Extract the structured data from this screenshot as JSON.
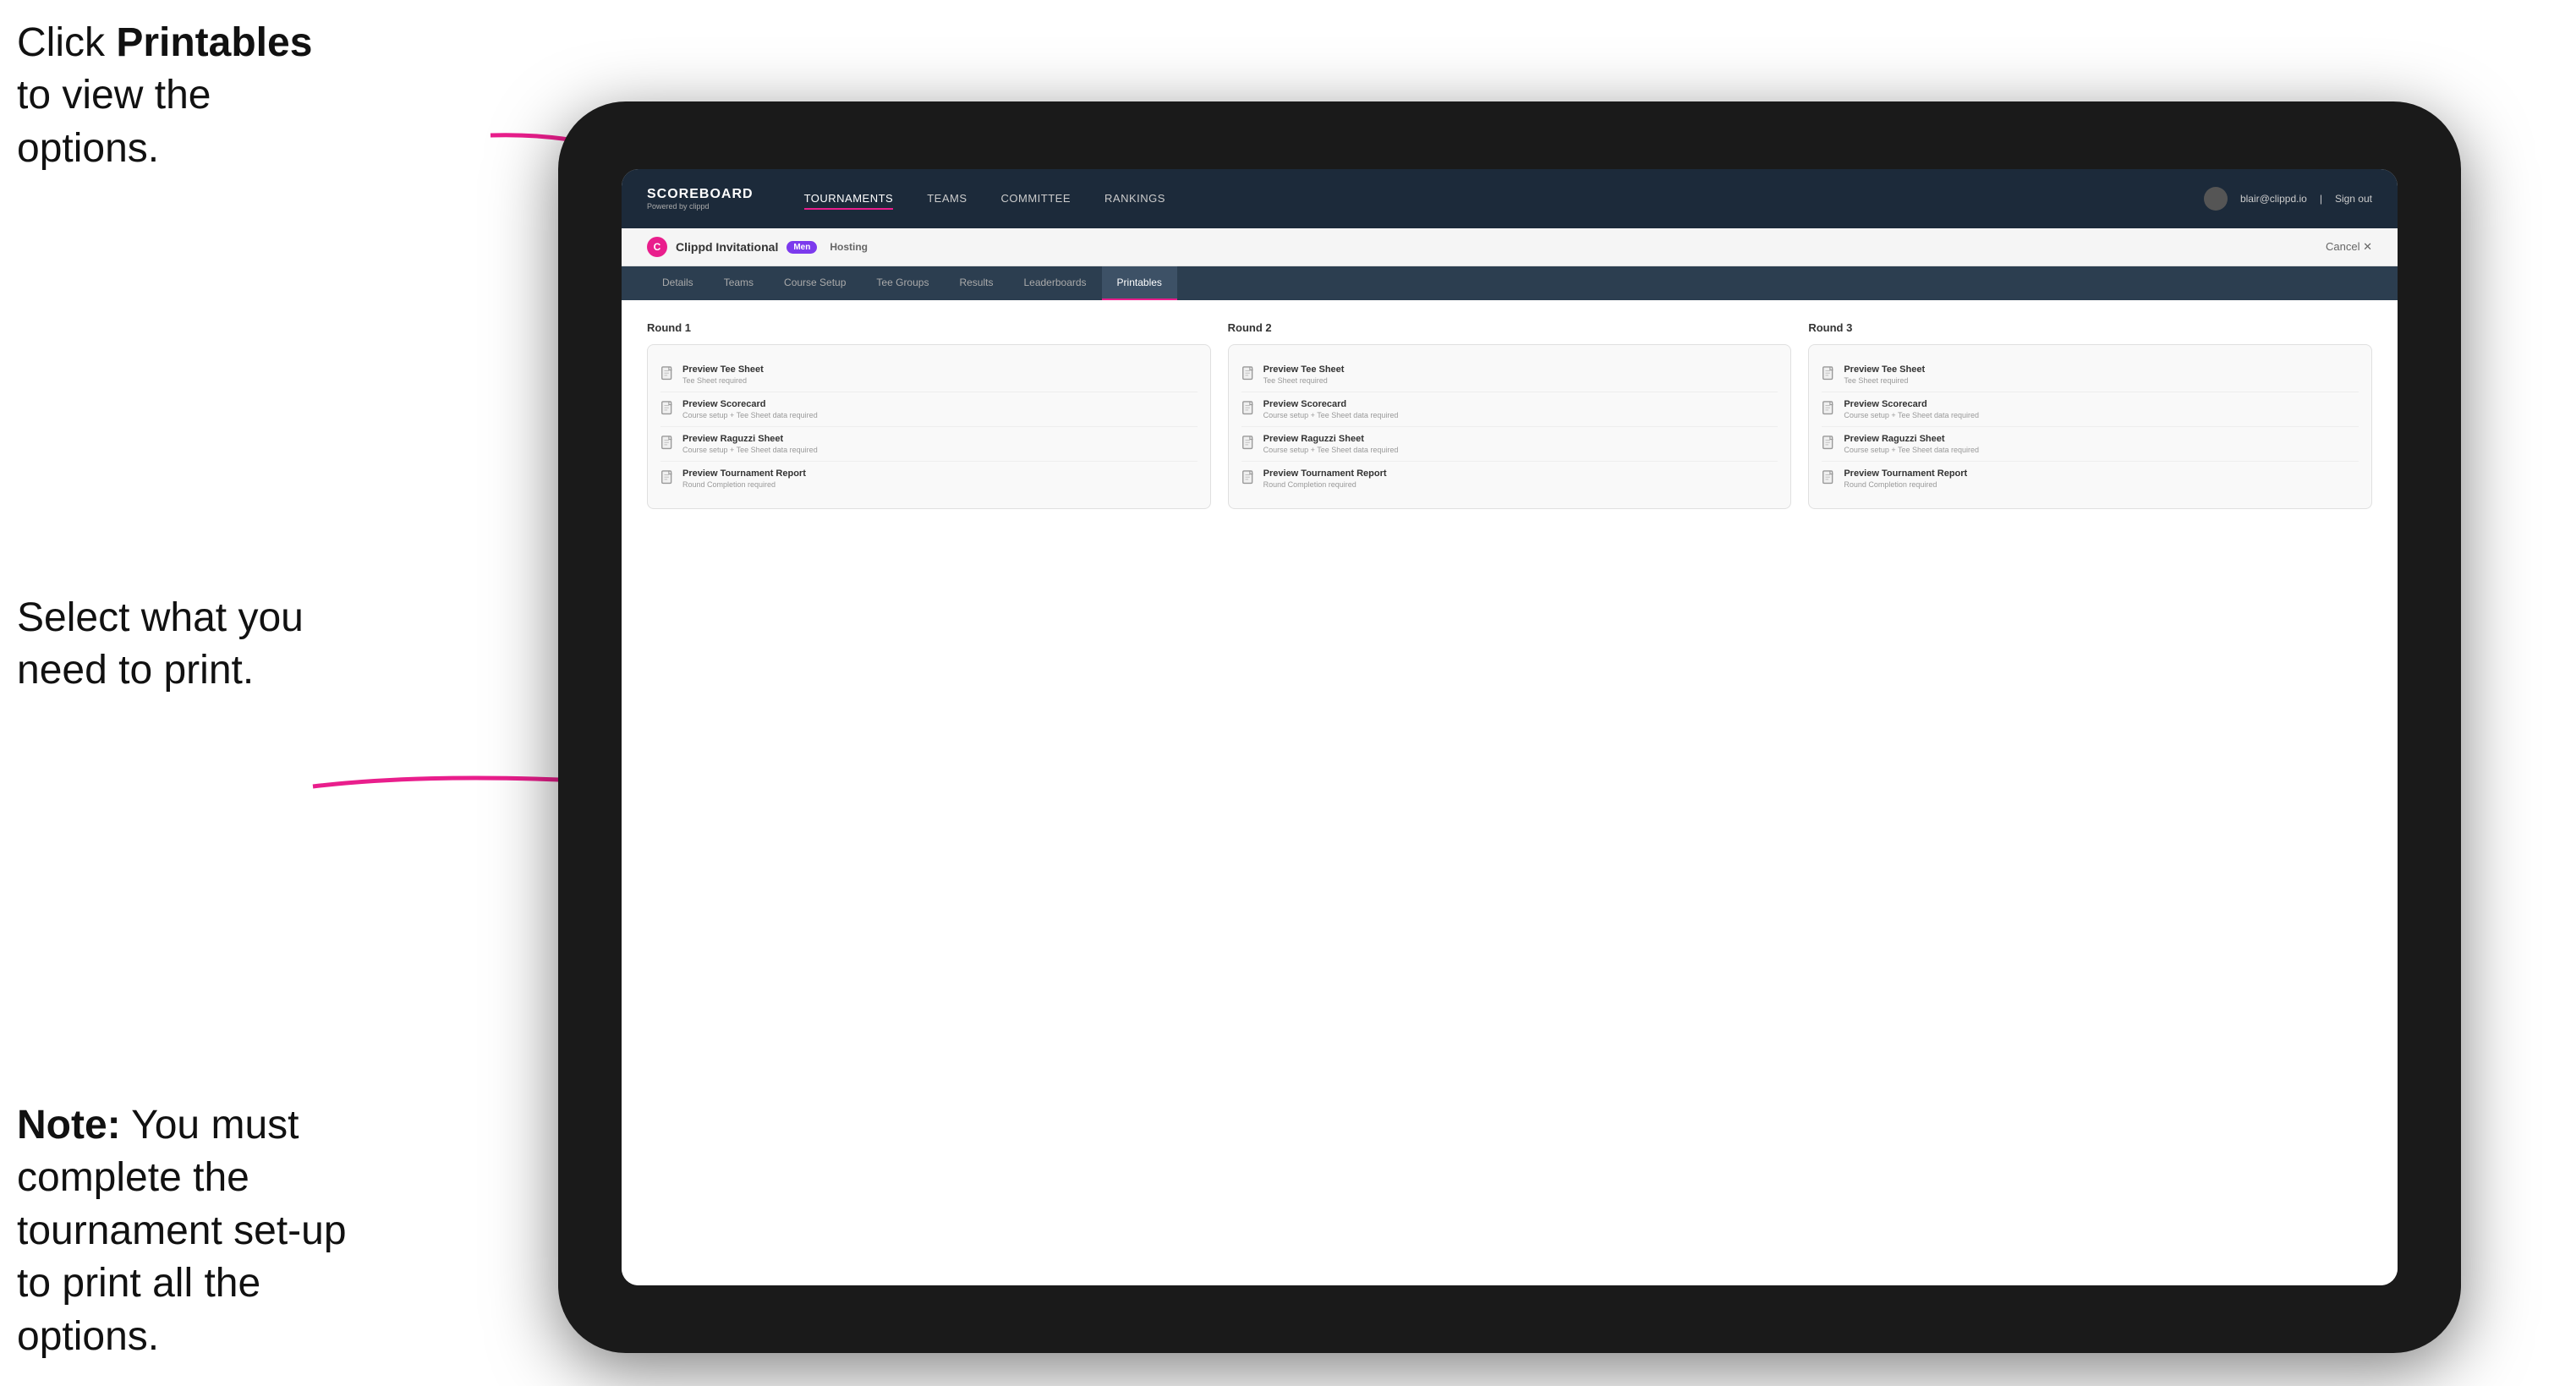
{
  "instructions": {
    "top": "Click ",
    "top_bold": "Printables",
    "top_rest": " to view the options.",
    "middle": "Select what you need to print.",
    "bottom_bold": "Note:",
    "bottom_rest": " You must complete the tournament set-up to print all the options."
  },
  "nav": {
    "logo_title": "SCOREBOARD",
    "logo_sub": "Powered by clippd",
    "links": [
      "TOURNAMENTS",
      "TEAMS",
      "COMMITTEE",
      "RANKINGS"
    ],
    "active_link": "TOURNAMENTS",
    "user_email": "blair@clippd.io",
    "sign_out": "Sign out"
  },
  "tournament": {
    "logo_letter": "C",
    "name": "Clippd Invitational",
    "gender": "Men",
    "status": "Hosting",
    "cancel_label": "Cancel ✕"
  },
  "tabs": {
    "items": [
      "Details",
      "Teams",
      "Course Setup",
      "Tee Groups",
      "Results",
      "Leaderboards",
      "Printables"
    ],
    "active": "Printables"
  },
  "rounds": [
    {
      "title": "Round 1",
      "items": [
        {
          "title": "Preview Tee Sheet",
          "subtitle": "Tee Sheet required"
        },
        {
          "title": "Preview Scorecard",
          "subtitle": "Course setup + Tee Sheet data required"
        },
        {
          "title": "Preview Raguzzi Sheet",
          "subtitle": "Course setup + Tee Sheet data required"
        },
        {
          "title": "Preview Tournament Report",
          "subtitle": "Round Completion required"
        }
      ]
    },
    {
      "title": "Round 2",
      "items": [
        {
          "title": "Preview Tee Sheet",
          "subtitle": "Tee Sheet required"
        },
        {
          "title": "Preview Scorecard",
          "subtitle": "Course setup + Tee Sheet data required"
        },
        {
          "title": "Preview Raguzzi Sheet",
          "subtitle": "Course setup + Tee Sheet data required"
        },
        {
          "title": "Preview Tournament Report",
          "subtitle": "Round Completion required"
        }
      ]
    },
    {
      "title": "Round 3",
      "items": [
        {
          "title": "Preview Tee Sheet",
          "subtitle": "Tee Sheet required"
        },
        {
          "title": "Preview Scorecard",
          "subtitle": "Course setup + Tee Sheet data required"
        },
        {
          "title": "Preview Raguzzi Sheet",
          "subtitle": "Course setup + Tee Sheet data required"
        },
        {
          "title": "Preview Tournament Report",
          "subtitle": "Round Completion required"
        }
      ]
    }
  ]
}
